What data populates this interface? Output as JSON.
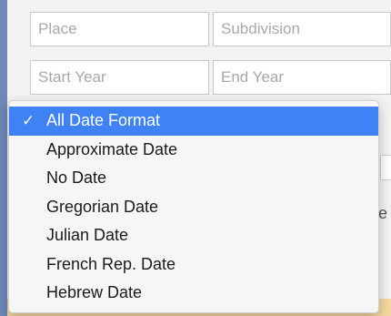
{
  "form": {
    "place_placeholder": "Place",
    "subdivision_placeholder": "Subdivision",
    "start_year_placeholder": "Start Year",
    "end_year_placeholder": "End Year"
  },
  "background": {
    "partial_text": "e"
  },
  "date_format_menu": {
    "check_glyph": "✓",
    "items": [
      {
        "label": "All Date Format",
        "selected": true
      },
      {
        "label": "Approximate Date",
        "selected": false
      },
      {
        "label": "No Date",
        "selected": false
      },
      {
        "label": "Gregorian Date",
        "selected": false
      },
      {
        "label": "Julian Date",
        "selected": false
      },
      {
        "label": "French Rep. Date",
        "selected": false
      },
      {
        "label": "Hebrew Date",
        "selected": false
      }
    ]
  },
  "colors": {
    "selection": "#3f82f5",
    "window_accent": "#6f88b8"
  }
}
